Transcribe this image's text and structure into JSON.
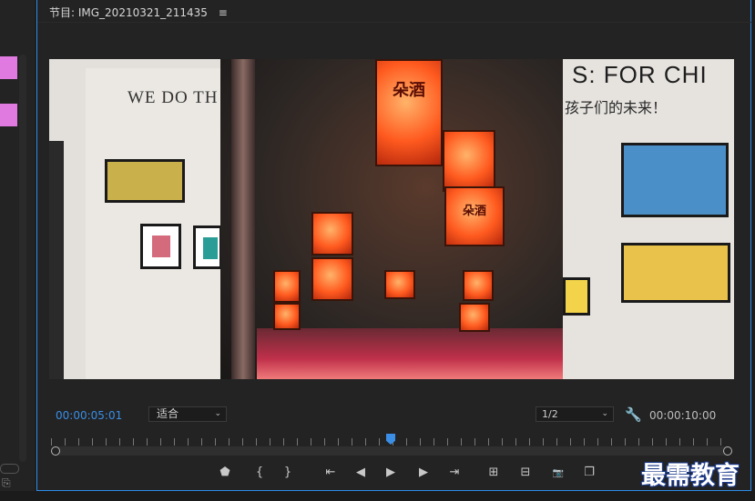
{
  "panel": {
    "tab_title": "节目: IMG_20210321_211435",
    "tab_menu_icon": "hamburger-menu-icon"
  },
  "viewer": {
    "wall_text_left": "WE DO TH",
    "wall_text_right": "S: FOR CHI",
    "wall_text_right_cn": "孩子们的未来！",
    "lantern_text": "朵酒"
  },
  "controls": {
    "current_time": "00:00:05:01",
    "zoom_value": "适合",
    "resolution_value": "1/2",
    "duration": "00:00:10:00",
    "playhead_progress": 0.5
  },
  "transport": {
    "buttons": [
      {
        "name": "add-marker-button",
        "icon": "marker-icon",
        "glyph": "⬟"
      },
      {
        "name": "mark-in-button",
        "icon": "mark-in-icon",
        "glyph": "{"
      },
      {
        "name": "mark-out-button",
        "icon": "mark-out-icon",
        "glyph": "}"
      },
      {
        "name": "go-to-in-button",
        "icon": "go-to-in-icon",
        "glyph": "⇤"
      },
      {
        "name": "step-back-button",
        "icon": "step-back-icon",
        "glyph": "◀"
      },
      {
        "name": "play-button",
        "icon": "play-icon",
        "glyph": "▶"
      },
      {
        "name": "step-forward-button",
        "icon": "step-forward-icon",
        "glyph": "▶"
      },
      {
        "name": "go-to-out-button",
        "icon": "go-to-out-icon",
        "glyph": "⇥"
      },
      {
        "name": "lift-button",
        "icon": "lift-icon",
        "glyph": "⊞"
      },
      {
        "name": "extract-button",
        "icon": "extract-icon",
        "glyph": "⊟"
      },
      {
        "name": "export-frame-button",
        "icon": "camera-icon",
        "glyph": "📷"
      },
      {
        "name": "comparison-view-button",
        "icon": "comparison-icon",
        "glyph": "❐"
      }
    ]
  },
  "watermark": "最需教育",
  "colors": {
    "accent": "#3a8ee6",
    "panel_border": "#2d8ceb",
    "label_pink": "#e07ae0"
  }
}
